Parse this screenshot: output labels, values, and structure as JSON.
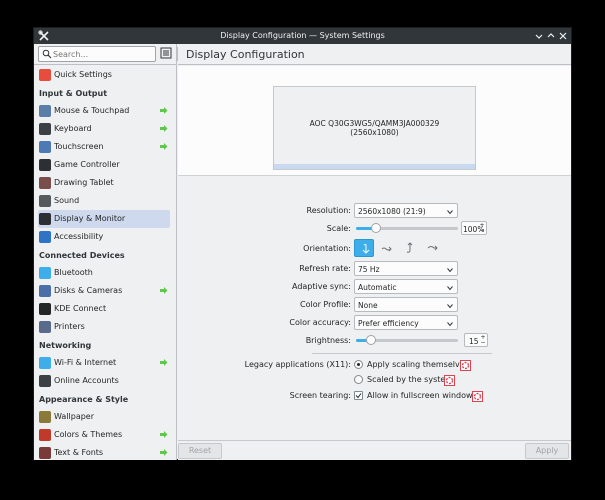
{
  "window": {
    "title": "Display Configuration — System Settings"
  },
  "sidebar": {
    "search_placeholder": "Search...",
    "quick_settings": "Quick Settings",
    "sections": [
      {
        "title": "Input & Output",
        "items": [
          {
            "label": "Mouse & Touchpad",
            "icon": "mouse-icon",
            "has_arrow": true
          },
          {
            "label": "Keyboard",
            "icon": "keyboard-icon",
            "has_arrow": true
          },
          {
            "label": "Touchscreen",
            "icon": "touchscreen-icon",
            "has_arrow": true
          },
          {
            "label": "Game Controller",
            "icon": "gamepad-icon",
            "has_arrow": false
          },
          {
            "label": "Drawing Tablet",
            "icon": "tablet-icon",
            "has_arrow": false
          },
          {
            "label": "Sound",
            "icon": "speaker-icon",
            "has_arrow": false
          },
          {
            "label": "Display & Monitor",
            "icon": "monitor-icon",
            "has_arrow": false,
            "active": true
          },
          {
            "label": "Accessibility",
            "icon": "accessibility-icon",
            "has_arrow": false
          }
        ]
      },
      {
        "title": "Connected Devices",
        "items": [
          {
            "label": "Bluetooth",
            "icon": "bluetooth-icon",
            "has_arrow": false
          },
          {
            "label": "Disks & Cameras",
            "icon": "tools-icon",
            "has_arrow": true
          },
          {
            "label": "KDE Connect",
            "icon": "phone-icon",
            "has_arrow": false
          },
          {
            "label": "Printers",
            "icon": "printer-icon",
            "has_arrow": false
          }
        ]
      },
      {
        "title": "Networking",
        "items": [
          {
            "label": "Wi-Fi & Internet",
            "icon": "network-icon",
            "has_arrow": true
          },
          {
            "label": "Online Accounts",
            "icon": "accounts-icon",
            "has_arrow": false
          }
        ]
      },
      {
        "title": "Appearance & Style",
        "items": [
          {
            "label": "Wallpaper",
            "icon": "wallpaper-icon",
            "has_arrow": false
          },
          {
            "label": "Colors & Themes",
            "icon": "palette-icon",
            "has_arrow": true
          },
          {
            "label": "Text & Fonts",
            "icon": "font-icon",
            "has_arrow": true
          }
        ]
      }
    ]
  },
  "main": {
    "page_title": "Display Configuration",
    "monitor": {
      "name": "AOC Q30G3WG5/QAMM3JA000329",
      "resolution": "(2560x1080)"
    },
    "form": {
      "resolution": {
        "label": "Resolution:",
        "value": "2560x1080 (21:9)"
      },
      "scale": {
        "label": "Scale:",
        "value": "100%",
        "level": 0.2
      },
      "orientation": {
        "label": "Orientation:"
      },
      "refresh_rate": {
        "label": "Refresh rate:",
        "value": "75 Hz"
      },
      "adaptive_sync": {
        "label": "Adaptive sync:",
        "value": "Automatic"
      },
      "color_profile": {
        "label": "Color Profile:",
        "value": "None"
      },
      "color_accuracy": {
        "label": "Color accuracy:",
        "value": "Prefer efficiency"
      },
      "brightness": {
        "label": "Brightness:",
        "value": "15",
        "level": 0.15
      },
      "legacy": {
        "label": "Legacy applications (X11):",
        "option1": "Apply scaling themselves",
        "option2": "Scaled by the system"
      },
      "tearing": {
        "label": "Screen tearing:",
        "option": "Allow in fullscreen windows"
      }
    },
    "footer": {
      "reset": "Reset",
      "apply": "Apply"
    }
  },
  "colors": {
    "accent": "#3daee9",
    "titlebar": "#31363b",
    "selection": "#cfd9ee",
    "arrow_green": "#5fc74a"
  }
}
